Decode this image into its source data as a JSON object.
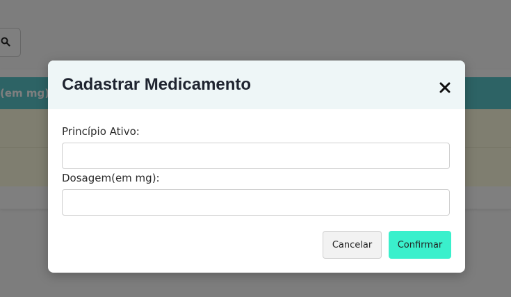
{
  "background": {
    "table_header_partial": "(em mg)"
  },
  "modal": {
    "title": "Cadastrar Medicamento",
    "fields": [
      {
        "label": "Princípio Ativo:",
        "value": "",
        "placeholder": ""
      },
      {
        "label": "Dosagem(em mg):",
        "value": "",
        "placeholder": ""
      }
    ],
    "buttons": {
      "cancel_label": "Cancelar",
      "confirm_label": "Confirmar"
    }
  },
  "colors": {
    "table_header": "#5bc7cb",
    "row_bg": "#fffde0",
    "modal_header_bg": "#eef6f7",
    "confirm_button": "#3af0cc",
    "overlay": "rgba(0,0,0,0.5)"
  },
  "icons": {
    "search": "search-icon",
    "close": "close-icon"
  }
}
